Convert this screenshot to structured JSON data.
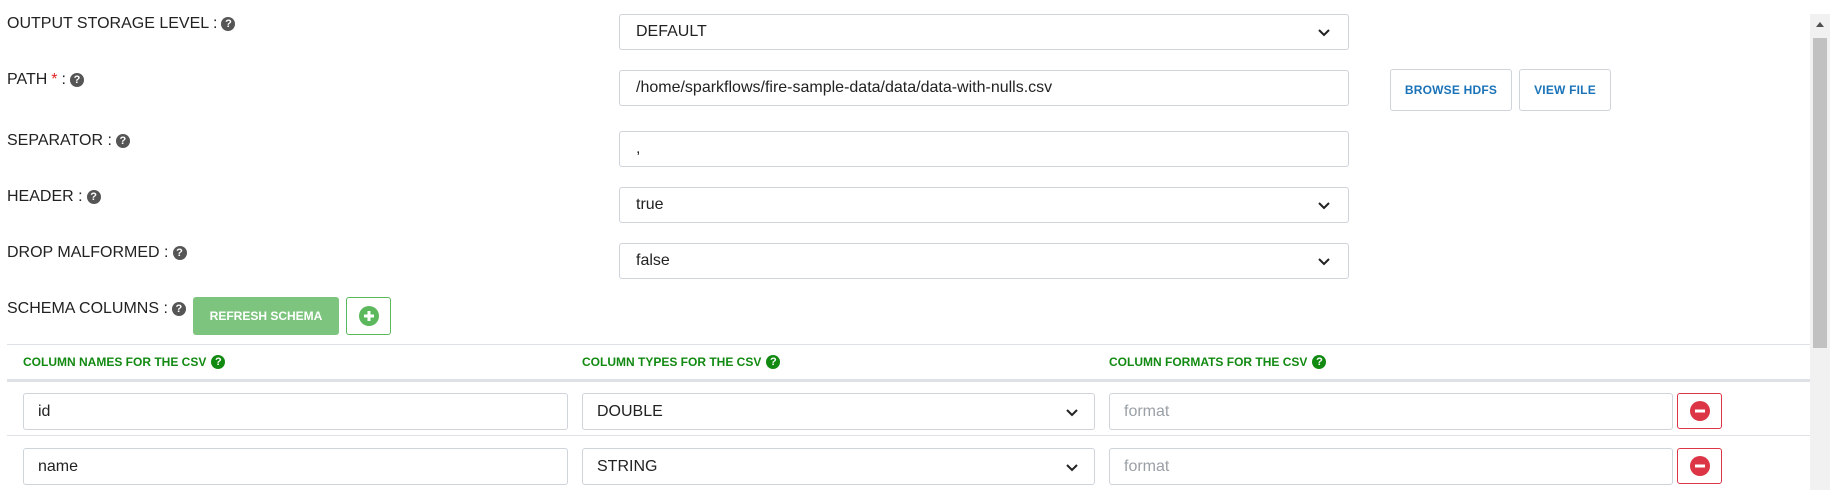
{
  "form": {
    "output_storage_level": {
      "label": "OUTPUT STORAGE LEVEL :",
      "value": "DEFAULT"
    },
    "path": {
      "label": "PATH",
      "required_mark": "*",
      "colon": " :",
      "value": "/home/sparkflows/fire-sample-data/data/data-with-nulls.csv"
    },
    "separator": {
      "label": "SEPARATOR :",
      "value": ","
    },
    "header": {
      "label": "HEADER :",
      "value": "true"
    },
    "drop_malformed": {
      "label": "DROP MALFORMED :",
      "value": "false"
    },
    "schema_columns": {
      "label": "SCHEMA COLUMNS :"
    }
  },
  "buttons": {
    "browse_hdfs": "BROWSE HDFS",
    "view_file": "VIEW FILE",
    "refresh_schema": "REFRESH SCHEMA"
  },
  "schema_table": {
    "headers": [
      "COLUMN NAMES FOR THE CSV",
      "COLUMN TYPES FOR THE CSV",
      "COLUMN FORMATS FOR THE CSV"
    ],
    "rows": [
      {
        "name": "id",
        "type": "DOUBLE",
        "format_placeholder": "format"
      },
      {
        "name": "name",
        "type": "STRING",
        "format_placeholder": "format"
      }
    ]
  },
  "icons": {
    "help": "question-circle-icon",
    "chevron": "chevron-down-icon",
    "add": "plus-circle-icon",
    "remove": "minus-circle-icon"
  },
  "colors": {
    "accent_blue": "#1a73b8",
    "success_green": "#128a12",
    "refresh_green": "#7dc47f",
    "danger_red": "#dc3545"
  }
}
